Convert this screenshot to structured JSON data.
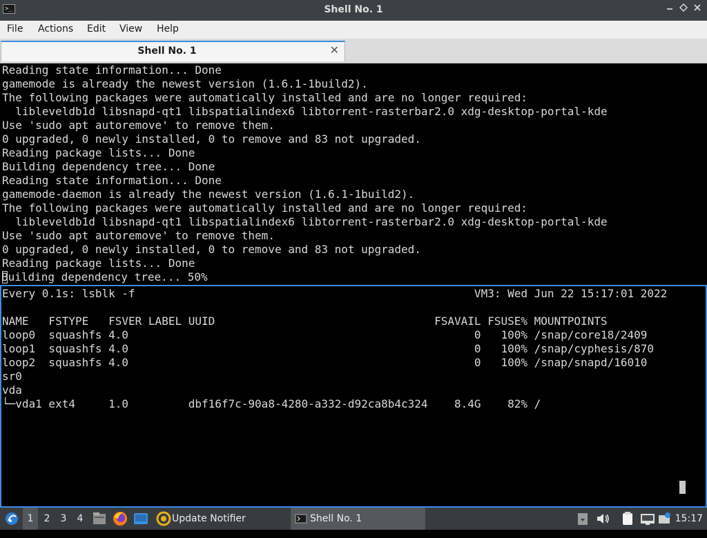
{
  "window": {
    "title": "Shell No. 1",
    "minimize": "_",
    "maximize": "⌃",
    "restore": "◇",
    "close": "✕"
  },
  "menubar": {
    "items": [
      "File",
      "Actions",
      "Edit",
      "View",
      "Help"
    ]
  },
  "tab": {
    "label": "Shell No. 1",
    "close": "✕"
  },
  "terminal_top": {
    "lines": [
      "Reading state information... Done",
      "gamemode is already the newest version (1.6.1-1build2).",
      "The following packages were automatically installed and are no longer required:",
      "  libleveldb1d libsnapd-qt1 libspatialindex6 libtorrent-rasterbar2.0 xdg-desktop-portal-kde",
      "Use 'sudo apt autoremove' to remove them.",
      "0 upgraded, 0 newly installed, 0 to remove and 83 not upgraded.",
      "Reading package lists... Done",
      "Building dependency tree... Done",
      "Reading state information... Done",
      "gamemode-daemon is already the newest version (1.6.1-1build2).",
      "The following packages were automatically installed and are no longer required:",
      "  libleveldb1d libsnapd-qt1 libspatialindex6 libtorrent-rasterbar2.0 xdg-desktop-portal-kde",
      "Use 'sudo apt autoremove' to remove them.",
      "0 upgraded, 0 newly installed, 0 to remove and 83 not upgraded.",
      "Reading package lists... Done"
    ],
    "last_line_cursor_char": "B",
    "last_line_rest": "uilding dependency tree... 50%"
  },
  "terminal_bottom": {
    "text": "Every 0.1s: lsblk -f                                                   VM3: Wed Jun 22 15:17:01 2022\n\nNAME   FSTYPE   FSVER LABEL UUID                                 FSAVAIL FSUSE% MOUNTPOINTS\nloop0  squashfs 4.0                                                    0   100% /snap/core18/2409\nloop1  squashfs 4.0                                                    0   100% /snap/cyphesis/870\nloop2  squashfs 4.0                                                    0   100% /snap/snapd/16010\nsr0\nvda\n└─vda1 ext4     1.0         dbf16f7c-90a8-4280-a332-d92ca8b4c324    8.4G    82% /"
  },
  "taskbar": {
    "workspaces": [
      "1",
      "2",
      "3",
      "4"
    ],
    "tasks": [
      {
        "label": "Update Notifier"
      },
      {
        "label": "Shell No. 1"
      }
    ],
    "clock": "15:17"
  },
  "colors": {
    "accent": "#3b8de0",
    "titlebar": "#3d4044",
    "taskbar": "#383c40",
    "terminal_fg": "#d8d8d8"
  }
}
